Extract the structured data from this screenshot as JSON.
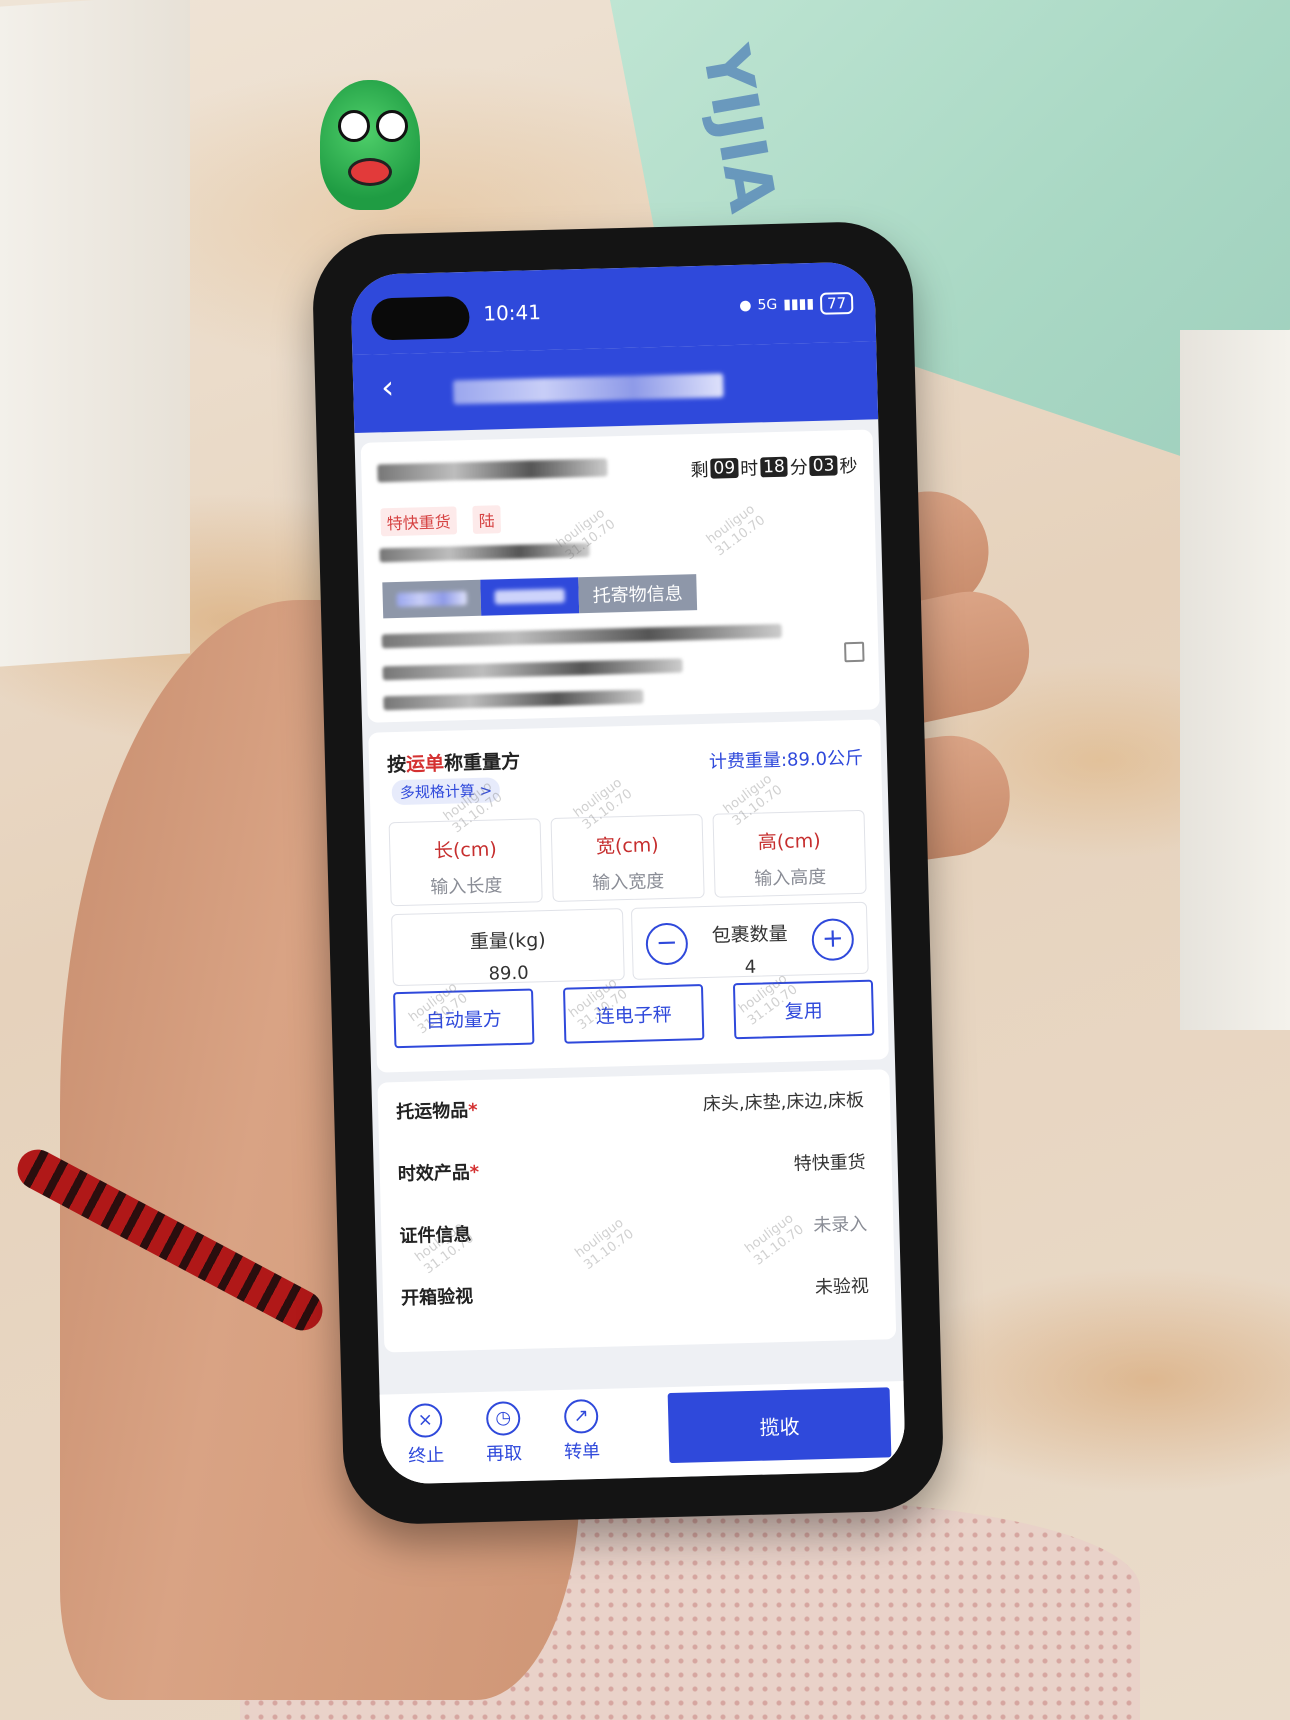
{
  "status_bar": {
    "time": "10:41",
    "network": "5G",
    "battery": "77"
  },
  "timer": {
    "prefix": "剩",
    "hours": "09",
    "h_unit": "时",
    "minutes": "18",
    "m_unit": "分",
    "seconds": "03",
    "s_unit": "秒"
  },
  "tags": [
    "特快重货",
    "陆"
  ],
  "tabs": {
    "third_label": "托寄物信息"
  },
  "measure": {
    "title_prefix": "按",
    "title_highlight": "运单",
    "title_suffix": "称重量方",
    "spec_link": "多规格计算 >",
    "fee_weight": "计费重量:89.0公斤",
    "length": {
      "label": "长(cm)",
      "placeholder": "输入长度"
    },
    "width": {
      "label": "宽(cm)",
      "placeholder": "输入宽度"
    },
    "height": {
      "label": "高(cm)",
      "placeholder": "输入高度"
    },
    "weight": {
      "label": "重量(kg)",
      "value": "89.0"
    },
    "package_count": {
      "label": "包裹数量",
      "value": "4"
    },
    "buttons": {
      "auto": "自动量方",
      "scale": "连电子秤",
      "reuse": "复用"
    }
  },
  "details": [
    {
      "key": "托运物品",
      "required": "*",
      "value": "床头,床垫,床边,床板"
    },
    {
      "key": "时效产品",
      "required": "*",
      "value": "特快重货"
    },
    {
      "key": "证件信息",
      "required": "",
      "value": "未录入"
    },
    {
      "key": "开箱验视",
      "required": "",
      "value": "未验视"
    }
  ],
  "footer": {
    "terminate": "终止",
    "retake": "再取",
    "transfer": "转单",
    "collect": "揽收"
  },
  "watermark": {
    "user": "houliguo",
    "code": "31.10.70"
  },
  "colors": {
    "primary": "#2f49db",
    "accent_red": "#d43131"
  }
}
